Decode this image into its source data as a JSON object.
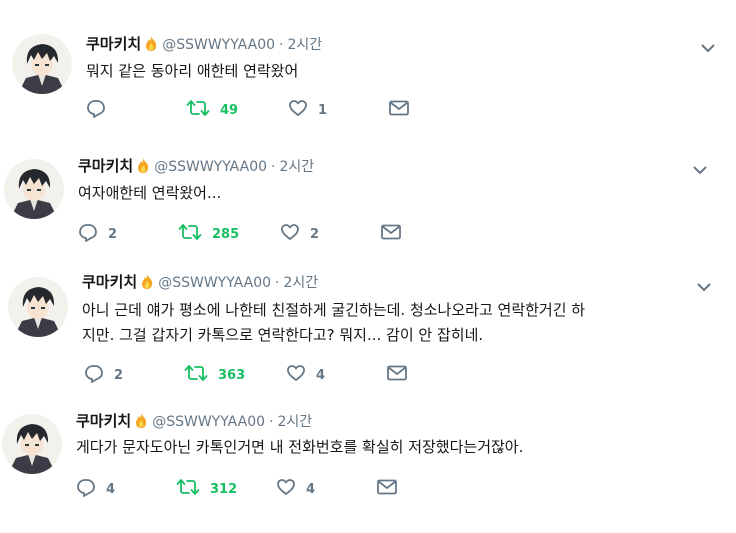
{
  "tweets": [
    {
      "author": "쿠마키치",
      "handle": "@SSWWYYAA00",
      "time": "2시간",
      "text": "뭐지 같은 동아리 애한테 연락왔어",
      "replies": "",
      "retweets": "49",
      "likes": "1"
    },
    {
      "author": "쿠마키치",
      "handle": "@SSWWYYAA00",
      "time": "2시간",
      "text": "여자애한테 연락왔어...",
      "replies": "2",
      "retweets": "285",
      "likes": "2"
    },
    {
      "author": "쿠마키치",
      "handle": "@SSWWYYAA00",
      "time": "2시간",
      "text_lines": [
        "아니 근데 얘가 평소에 나한테 친절하게 굴긴하는데. 청소나오라고 연락한거긴 하",
        "지만. 그걸 갑자기 카톡으로 연락한다고? 뭐지... 감이 안 잡히네."
      ],
      "replies": "2",
      "retweets": "363",
      "likes": "4"
    },
    {
      "author": "쿠마키치",
      "handle": "@SSWWYYAA00",
      "time": "2시간",
      "text": "게다가 문자도아닌 카톡인거면 내 전화번호를 확실히 저장했다는거잖아.",
      "replies": "4",
      "retweets": "312",
      "likes": "4"
    }
  ],
  "meta": {
    "separator": "·"
  },
  "colors": {
    "retweet": "#17bf63",
    "muted": "#657786",
    "text": "#14171a",
    "flame": "#f5a623"
  },
  "icons": [
    "reply-icon",
    "retweet-icon",
    "like-icon",
    "message-icon",
    "chevron-down-icon",
    "fire-icon"
  ]
}
